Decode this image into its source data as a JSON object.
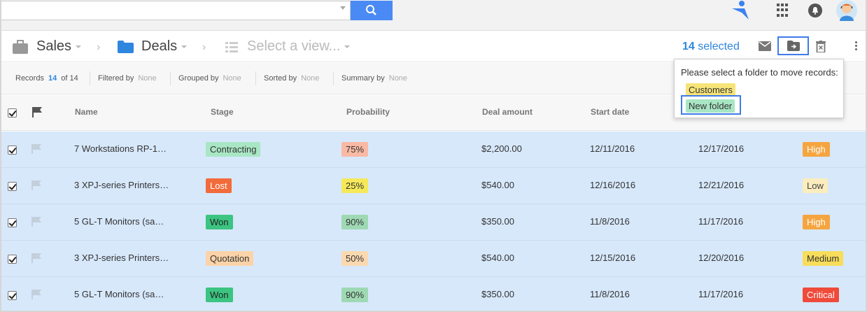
{
  "search": {
    "value": "",
    "placeholder": ""
  },
  "breadcrumb": {
    "items": [
      {
        "label": "Sales",
        "icon": "briefcase-icon"
      },
      {
        "label": "Deals",
        "icon": "folder-icon"
      },
      {
        "label": "Select a view...",
        "icon": "list-view-icon"
      }
    ]
  },
  "toolbar": {
    "selected_count": "14",
    "selected_label": "selected",
    "icons": [
      "mail-icon",
      "move-to-folder-icon",
      "delete-icon",
      "more-vert-icon"
    ]
  },
  "summary": {
    "records_label": "Records",
    "records_count": "14",
    "records_of": "of 14",
    "filtered_label": "Filtered by",
    "filtered_value": "None",
    "grouped_label": "Grouped by",
    "grouped_value": "None",
    "sorted_label": "Sorted by",
    "sorted_value": "None",
    "summary_label": "Summary by",
    "summary_value": "None"
  },
  "table": {
    "headers": [
      "Name",
      "Stage",
      "Probability",
      "Deal amount",
      "Start date"
    ],
    "rows": [
      {
        "name": "7 Workstations RP-1…",
        "stage": "Contracting",
        "probability": "75%",
        "amount": "$2,200.00",
        "start": "12/11/2016",
        "end": "12/17/2016",
        "priority": "High"
      },
      {
        "name": "3 XPJ-series Printers…",
        "stage": "Lost",
        "probability": "25%",
        "amount": "$540.00",
        "start": "12/16/2016",
        "end": "12/21/2016",
        "priority": "Low"
      },
      {
        "name": "5 GL-T Monitors (sa…",
        "stage": "Won",
        "probability": "90%",
        "amount": "$350.00",
        "start": "11/8/2016",
        "end": "11/17/2016",
        "priority": "High"
      },
      {
        "name": "3 XPJ-series Printers…",
        "stage": "Quotation",
        "probability": "50%",
        "amount": "$540.00",
        "start": "12/15/2016",
        "end": "12/20/2016",
        "priority": "Medium"
      },
      {
        "name": "5 GL-T Monitors (sa…",
        "stage": "Won",
        "probability": "90%",
        "amount": "$350.00",
        "start": "11/8/2016",
        "end": "11/17/2016",
        "priority": "Critical"
      }
    ]
  },
  "popup": {
    "message": "Please select a folder to move records:",
    "folders": [
      "Customers",
      "New folder"
    ]
  },
  "colors": {
    "accent": "#2f86de",
    "search_button": "#4a8af4",
    "row_selected": "#d7e8fb",
    "stage_contracting": "#a8e6c4",
    "stage_lost": "#f26b3a",
    "stage_won": "#3cc481",
    "stage_quotation": "#fcd3a8",
    "prob_75": "#f9b9a4",
    "prob_25": "#f5e95a",
    "prob_90": "#9ed9b3",
    "prob_50": "#fbd9b0",
    "priority_high": "#f5a540",
    "priority_low": "#fbedbd",
    "priority_medium": "#f7dd5a",
    "priority_critical": "#ef4a3a"
  }
}
